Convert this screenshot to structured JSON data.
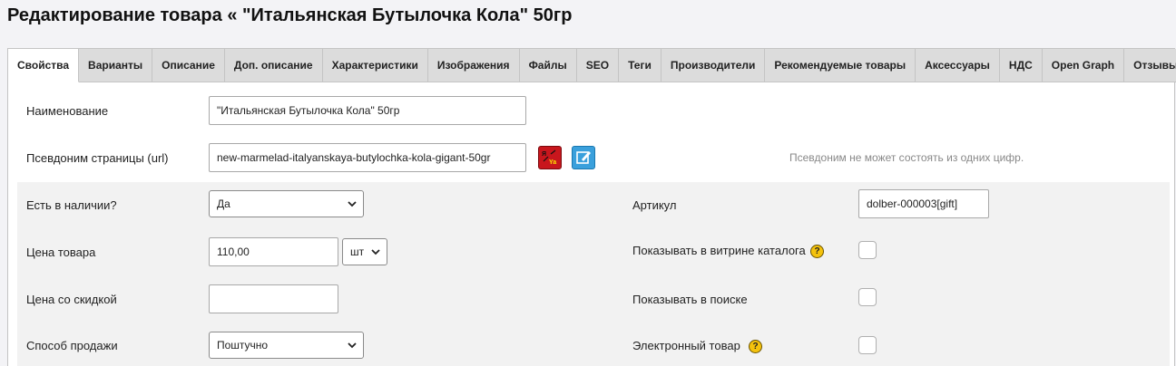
{
  "page": {
    "title": "Редактирование товара « \"Итальянская Бутылочка Кола\" 50гр"
  },
  "tabs": [
    {
      "label": "Свойства",
      "active": true
    },
    {
      "label": "Варианты"
    },
    {
      "label": "Описание"
    },
    {
      "label": "Доп. описание"
    },
    {
      "label": "Характеристики"
    },
    {
      "label": "Изображения"
    },
    {
      "label": "Файлы"
    },
    {
      "label": "SEO"
    },
    {
      "label": "Теги"
    },
    {
      "label": "Производители"
    },
    {
      "label": "Рекомендуемые товары"
    },
    {
      "label": "Аксессуары"
    },
    {
      "label": "НДС"
    },
    {
      "label": "Open Graph"
    },
    {
      "label": "Отзывы"
    }
  ],
  "form": {
    "name": {
      "label": "Наименование",
      "value": "\"Итальянская Бутылочка Кола\" 50гр"
    },
    "url": {
      "label": "Псевдоним страницы (url)",
      "value": "new-marmelad-italyanskaya-butylochka-kola-gigant-50gr",
      "hint": "Псевдоним не может состоять из одних цифр.",
      "translit_icon": "translit-icon",
      "edit_icon": "edit-icon"
    },
    "in_stock": {
      "label": "Есть в наличии?",
      "value": "Да"
    },
    "price": {
      "label": "Цена товара",
      "value": "110,00",
      "unit": "шт"
    },
    "discount_price": {
      "label": "Цена со скидкой",
      "value": ""
    },
    "sale_method": {
      "label": "Способ продажи",
      "value": "Поштучно"
    },
    "sku": {
      "label": "Артикул",
      "value": "dolber-000003[gift]"
    },
    "show_in_catalog": {
      "label": "Показывать в витрине каталога",
      "checked": false
    },
    "show_in_search": {
      "label": "Показывать в поиске",
      "checked": false
    },
    "electronic": {
      "label": "Электронный товар",
      "checked": false
    },
    "help_icon": "?"
  },
  "colors": {
    "translit": "#c8161d",
    "edit": "#3aa0dc",
    "help": "#f4c20d"
  }
}
